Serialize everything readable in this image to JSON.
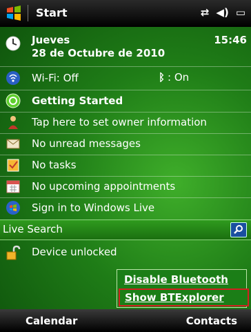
{
  "titlebar": {
    "title": "Start"
  },
  "today": {
    "time": "15:46",
    "day": "Jueves",
    "date": "28 de Octubre de 2010",
    "wifi": "Wi-Fi: Off",
    "bluetooth": ": On",
    "getting_started": "Getting Started",
    "owner": "Tap here to set owner information",
    "messages": "No unread messages",
    "tasks": "No tasks",
    "appointments": "No upcoming appointments",
    "windows_live": "Sign in to Windows Live",
    "live_search": "Live Search",
    "device_lock": "Device unlocked"
  },
  "menu": {
    "items": [
      "Disable Bluetooth",
      "Show BTExplorer"
    ]
  },
  "softkeys": {
    "left": "Calendar",
    "right": "Contacts"
  },
  "colors": {
    "background": "#1f7d17",
    "highlight": "#d32020",
    "menu_bg": "#1b7e17"
  },
  "icons": {
    "title": "windows-logo-icon",
    "connectivity": "connectivity-icon",
    "volume": "volume-icon",
    "battery": "battery-icon",
    "clock": "clock-icon",
    "wifi": "wifi-icon",
    "bt": "bluetooth-icon",
    "gs": "getting-started-icon",
    "owner": "owner-icon",
    "msg": "envelope-icon",
    "task": "task-icon",
    "calendar": "calendar-icon",
    "live": "windows-live-icon",
    "search": "search-icon",
    "lock": "lock-icon"
  }
}
